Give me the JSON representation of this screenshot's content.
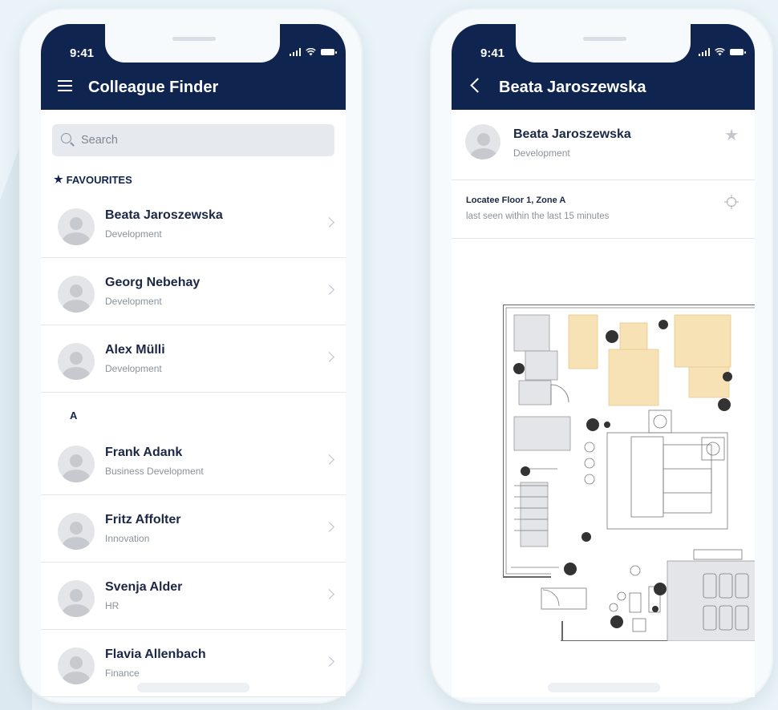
{
  "left_screen": {
    "status_time": "9:41",
    "title": "Colleague Finder",
    "search_placeholder": "Search",
    "favourites_label": "FAVOURITES",
    "favourites": [
      {
        "name": "Beata Jaroszewska",
        "dept": "Development"
      },
      {
        "name": "Georg Nebehay",
        "dept": "Development"
      },
      {
        "name": "Alex Mülli",
        "dept": "Development"
      }
    ],
    "section_a_label": "A",
    "contacts": [
      {
        "name": "Frank Adank",
        "dept": "Business Development"
      },
      {
        "name": "Fritz Affolter",
        "dept": "Innovation"
      },
      {
        "name": "Svenja Alder",
        "dept": "HR"
      },
      {
        "name": "Flavia Allenbach",
        "dept": "Finance"
      }
    ]
  },
  "right_screen": {
    "status_time": "9:41",
    "title": "Beata Jaroszewska",
    "profile": {
      "name": "Beata Jaroszewska",
      "dept": "Development"
    },
    "location": {
      "title": "Locatee Floor 1, Zone A",
      "last_seen": "last seen within the last 15 minutes"
    }
  },
  "colors": {
    "header": "#0f2550",
    "zone_highlight": "#f7e2b5",
    "background": "#e9f3f8"
  }
}
